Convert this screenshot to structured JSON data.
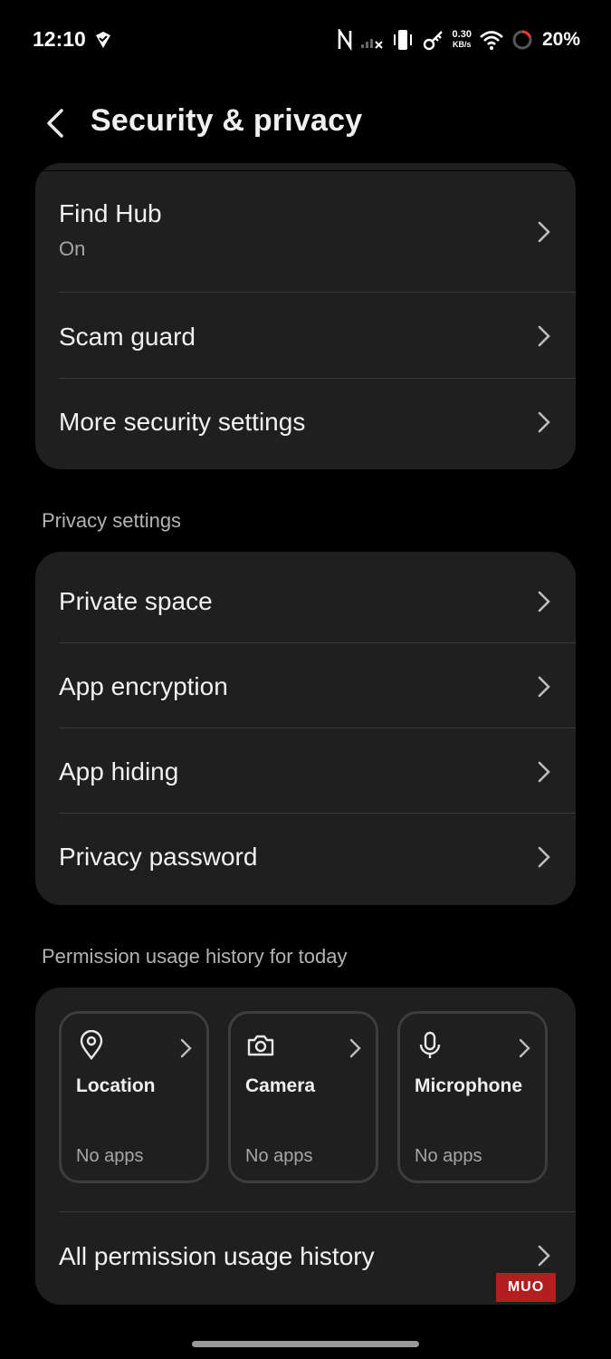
{
  "status_bar": {
    "time": "12:10",
    "net_speed_value": "0.30",
    "net_speed_unit": "KB/s",
    "battery": "20%"
  },
  "header": {
    "title": "Security & privacy"
  },
  "security_rows": [
    {
      "title": "Find Hub",
      "subtitle": "On"
    },
    {
      "title": "Scam guard"
    },
    {
      "title": "More security settings"
    }
  ],
  "privacy_section": {
    "header": "Privacy settings",
    "rows": [
      {
        "title": "Private space"
      },
      {
        "title": "App encryption"
      },
      {
        "title": "App hiding"
      },
      {
        "title": "Privacy password"
      }
    ]
  },
  "permission_section": {
    "header": "Permission usage history for today",
    "cards": [
      {
        "title": "Location",
        "subtitle": "No apps",
        "icon": "location-pin-icon"
      },
      {
        "title": "Camera",
        "subtitle": "No apps",
        "icon": "camera-icon"
      },
      {
        "title": "Microphone",
        "subtitle": "No apps",
        "icon": "microphone-icon"
      }
    ],
    "all_history_label": "All permission usage history"
  },
  "watermark": "MUO",
  "colors": {
    "background": "#000000",
    "card": "#1f1f1f",
    "divider": "#3a3a3a",
    "secondary_text": "#a6a6a6",
    "watermark": "#b31f1f"
  }
}
